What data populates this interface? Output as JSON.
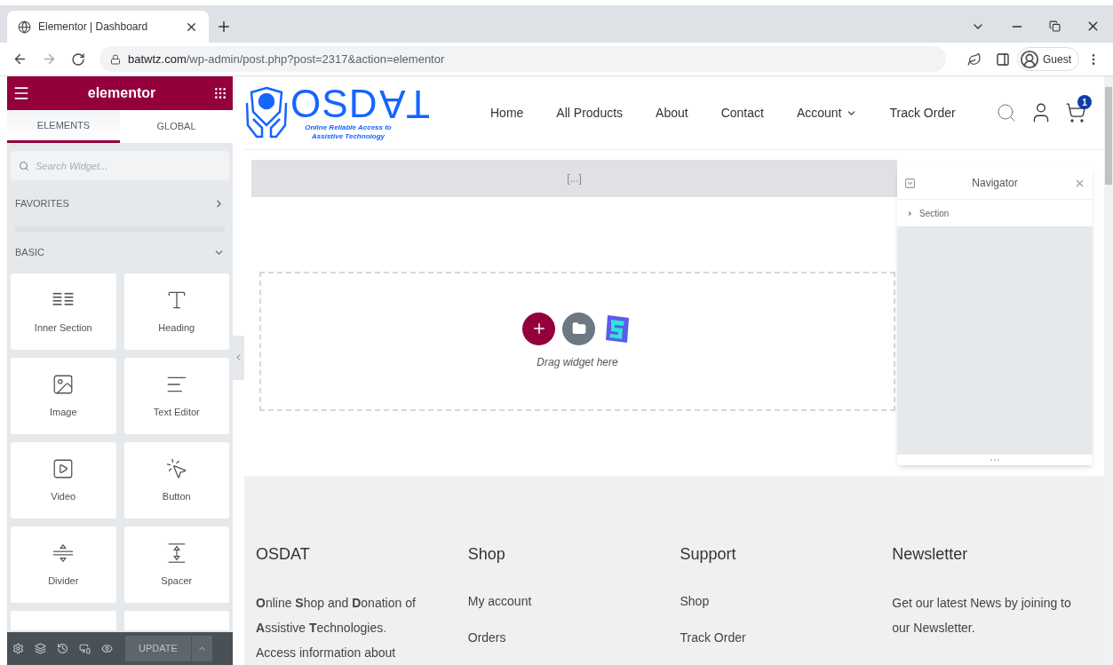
{
  "browser": {
    "tab_title": "Elementor | Dashboard",
    "url_host": "batwtz.com",
    "url_path": "/wp-admin/post.php?post=2317&action=elementor",
    "profile": "Guest"
  },
  "panel": {
    "brand": "elementor",
    "tabs": [
      {
        "label": "ELEMENTS",
        "selected": true
      },
      {
        "label": "GLOBAL",
        "selected": false
      }
    ],
    "search": {
      "placeholder": "Search Widget..."
    },
    "categories": [
      {
        "label": "FAVORITES",
        "expanded": false
      },
      {
        "label": "BASIC",
        "expanded": true
      }
    ],
    "widgets": [
      "Inner Section",
      "Heading",
      "Image",
      "Text Editor",
      "Video",
      "Button",
      "Divider",
      "Spacer"
    ],
    "update_label": "UPDATE"
  },
  "site": {
    "logo": {
      "letters": "OSD",
      "flipped_letters": "AT",
      "tagline": "Online Reliable Access to Assistive Technology"
    },
    "nav": [
      {
        "label": "Home",
        "dropdown": false
      },
      {
        "label": "All Products",
        "dropdown": false
      },
      {
        "label": "About",
        "dropdown": false
      },
      {
        "label": "Contact",
        "dropdown": false
      },
      {
        "label": "Account",
        "dropdown": true
      },
      {
        "label": "Track Order",
        "dropdown": false
      }
    ],
    "cart_count": "1",
    "placeholder_bar": "[...]",
    "drop_zone": {
      "hint": "Drag widget here"
    },
    "footer": [
      {
        "title": "OSDAT",
        "text": "**O**nline **S**hop and **D**onation of **A**ssistive **T**echnologies. Access information about"
      },
      {
        "title": "Shop",
        "links": [
          "My account",
          "Orders"
        ]
      },
      {
        "title": "Support",
        "links": [
          "Shop",
          "Track Order"
        ]
      },
      {
        "title": "Newsletter",
        "text": "Get our latest News by joining to our Newsletter."
      }
    ]
  },
  "navigator": {
    "title": "Navigator",
    "items": [
      {
        "label": "Section",
        "expanded": false
      }
    ]
  }
}
